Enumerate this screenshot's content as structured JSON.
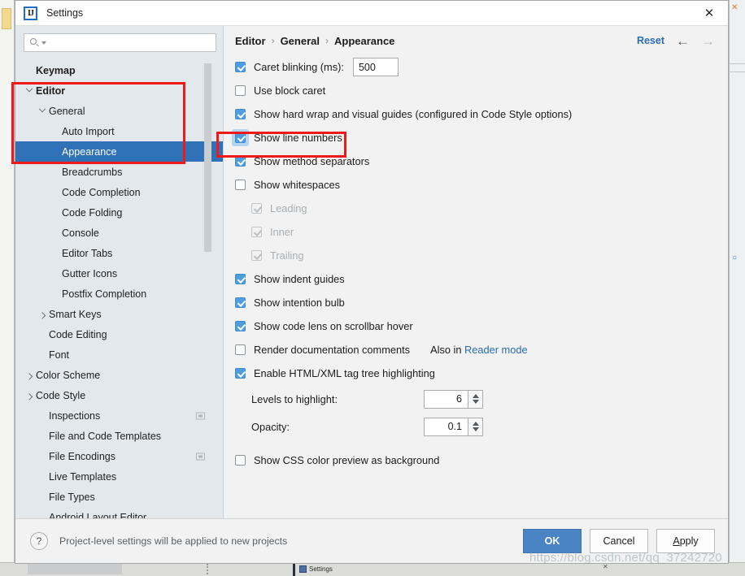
{
  "window": {
    "title": "Settings",
    "logo_text": "IJ",
    "close_label": "✕"
  },
  "search": {
    "value": "",
    "placeholder": ""
  },
  "sidebar": {
    "items": [
      {
        "label": "Keymap",
        "indent": 0,
        "twisty": "none",
        "bold": true,
        "selected": false,
        "badge": false
      },
      {
        "label": "Editor",
        "indent": 0,
        "twisty": "down",
        "bold": true,
        "selected": false,
        "badge": false
      },
      {
        "label": "General",
        "indent": 1,
        "twisty": "down",
        "bold": false,
        "selected": false,
        "badge": false
      },
      {
        "label": "Auto Import",
        "indent": 2,
        "twisty": "none",
        "bold": false,
        "selected": false,
        "badge": false
      },
      {
        "label": "Appearance",
        "indent": 2,
        "twisty": "none",
        "bold": false,
        "selected": true,
        "badge": false
      },
      {
        "label": "Breadcrumbs",
        "indent": 2,
        "twisty": "none",
        "bold": false,
        "selected": false,
        "badge": false
      },
      {
        "label": "Code Completion",
        "indent": 2,
        "twisty": "none",
        "bold": false,
        "selected": false,
        "badge": false
      },
      {
        "label": "Code Folding",
        "indent": 2,
        "twisty": "none",
        "bold": false,
        "selected": false,
        "badge": false
      },
      {
        "label": "Console",
        "indent": 2,
        "twisty": "none",
        "bold": false,
        "selected": false,
        "badge": false
      },
      {
        "label": "Editor Tabs",
        "indent": 2,
        "twisty": "none",
        "bold": false,
        "selected": false,
        "badge": false
      },
      {
        "label": "Gutter Icons",
        "indent": 2,
        "twisty": "none",
        "bold": false,
        "selected": false,
        "badge": false
      },
      {
        "label": "Postfix Completion",
        "indent": 2,
        "twisty": "none",
        "bold": false,
        "selected": false,
        "badge": false
      },
      {
        "label": "Smart Keys",
        "indent": 1,
        "twisty": "right",
        "bold": false,
        "selected": false,
        "badge": false
      },
      {
        "label": "Code Editing",
        "indent": 1,
        "twisty": "none",
        "bold": false,
        "selected": false,
        "badge": false
      },
      {
        "label": "Font",
        "indent": 1,
        "twisty": "none",
        "bold": false,
        "selected": false,
        "badge": false
      },
      {
        "label": "Color Scheme",
        "indent": 0,
        "twisty": "right",
        "bold": false,
        "selected": false,
        "badge": false
      },
      {
        "label": "Code Style",
        "indent": 0,
        "twisty": "right",
        "bold": false,
        "selected": false,
        "badge": false
      },
      {
        "label": "Inspections",
        "indent": 1,
        "twisty": "none",
        "bold": false,
        "selected": false,
        "badge": true
      },
      {
        "label": "File and Code Templates",
        "indent": 1,
        "twisty": "none",
        "bold": false,
        "selected": false,
        "badge": false
      },
      {
        "label": "File Encodings",
        "indent": 1,
        "twisty": "none",
        "bold": false,
        "selected": false,
        "badge": true
      },
      {
        "label": "Live Templates",
        "indent": 1,
        "twisty": "none",
        "bold": false,
        "selected": false,
        "badge": false
      },
      {
        "label": "File Types",
        "indent": 1,
        "twisty": "none",
        "bold": false,
        "selected": false,
        "badge": false
      },
      {
        "label": "Android Layout Editor",
        "indent": 1,
        "twisty": "none",
        "bold": false,
        "selected": false,
        "badge": false
      }
    ]
  },
  "breadcrumb": {
    "parts": [
      "Editor",
      "General",
      "Appearance"
    ],
    "separator": "›"
  },
  "toolbar": {
    "reset_label": "Reset",
    "back_arrow": "←",
    "forward_arrow": "→"
  },
  "settings": {
    "caret_blinking": {
      "label": "Caret blinking (ms):",
      "checked": true,
      "value": "500"
    },
    "use_block_caret": {
      "label": "Use block caret",
      "checked": false
    },
    "show_hard_wrap": {
      "label": "Show hard wrap and visual guides (configured in Code Style options)",
      "checked": true
    },
    "show_line_numbers": {
      "label": "Show line numbers",
      "checked": true,
      "focused": true
    },
    "show_method_separators": {
      "label": "Show method separators",
      "checked": true
    },
    "show_whitespaces": {
      "label": "Show whitespaces",
      "checked": false
    },
    "leading": {
      "label": "Leading",
      "checked": true,
      "disabled": true
    },
    "inner": {
      "label": "Inner",
      "checked": true,
      "disabled": true
    },
    "trailing": {
      "label": "Trailing",
      "checked": true,
      "disabled": true
    },
    "show_indent_guides": {
      "label": "Show indent guides",
      "checked": true
    },
    "show_intention_bulb": {
      "label": "Show intention bulb",
      "checked": true
    },
    "show_code_lens": {
      "label": "Show code lens on scrollbar hover",
      "checked": true
    },
    "render_doc_comments": {
      "label": "Render documentation comments",
      "checked": false,
      "suffix_prefix": "Also in ",
      "suffix_link": "Reader mode"
    },
    "enable_html_xml": {
      "label": "Enable HTML/XML tag tree highlighting",
      "checked": true
    },
    "levels_to_highlight": {
      "label": "Levels to highlight:",
      "value": "6"
    },
    "opacity": {
      "label": "Opacity:",
      "value": "0.1"
    },
    "show_css_color_preview": {
      "label": "Show CSS color preview as background",
      "checked": false
    }
  },
  "footer": {
    "help_glyph": "?",
    "note": "Project-level settings will be applied to new projects",
    "ok_label": "OK",
    "cancel_label": "Cancel",
    "apply_mnemonic": "A",
    "apply_rest": "pply"
  },
  "watermark": "https://blog.csdn.net/qq_37242720",
  "background": {
    "taskbar_item_label": "Settings",
    "taskbar_close": "✕"
  },
  "colors": {
    "selection_blue": "#2f72b8",
    "checkbox_blue": "#4d9de0",
    "link_blue": "#2a6db5",
    "primary_button": "#4a84c4",
    "annotation_red": "#f01919",
    "sidebar_bg": "#e3e8ec",
    "content_bg": "#f2f2f2"
  }
}
